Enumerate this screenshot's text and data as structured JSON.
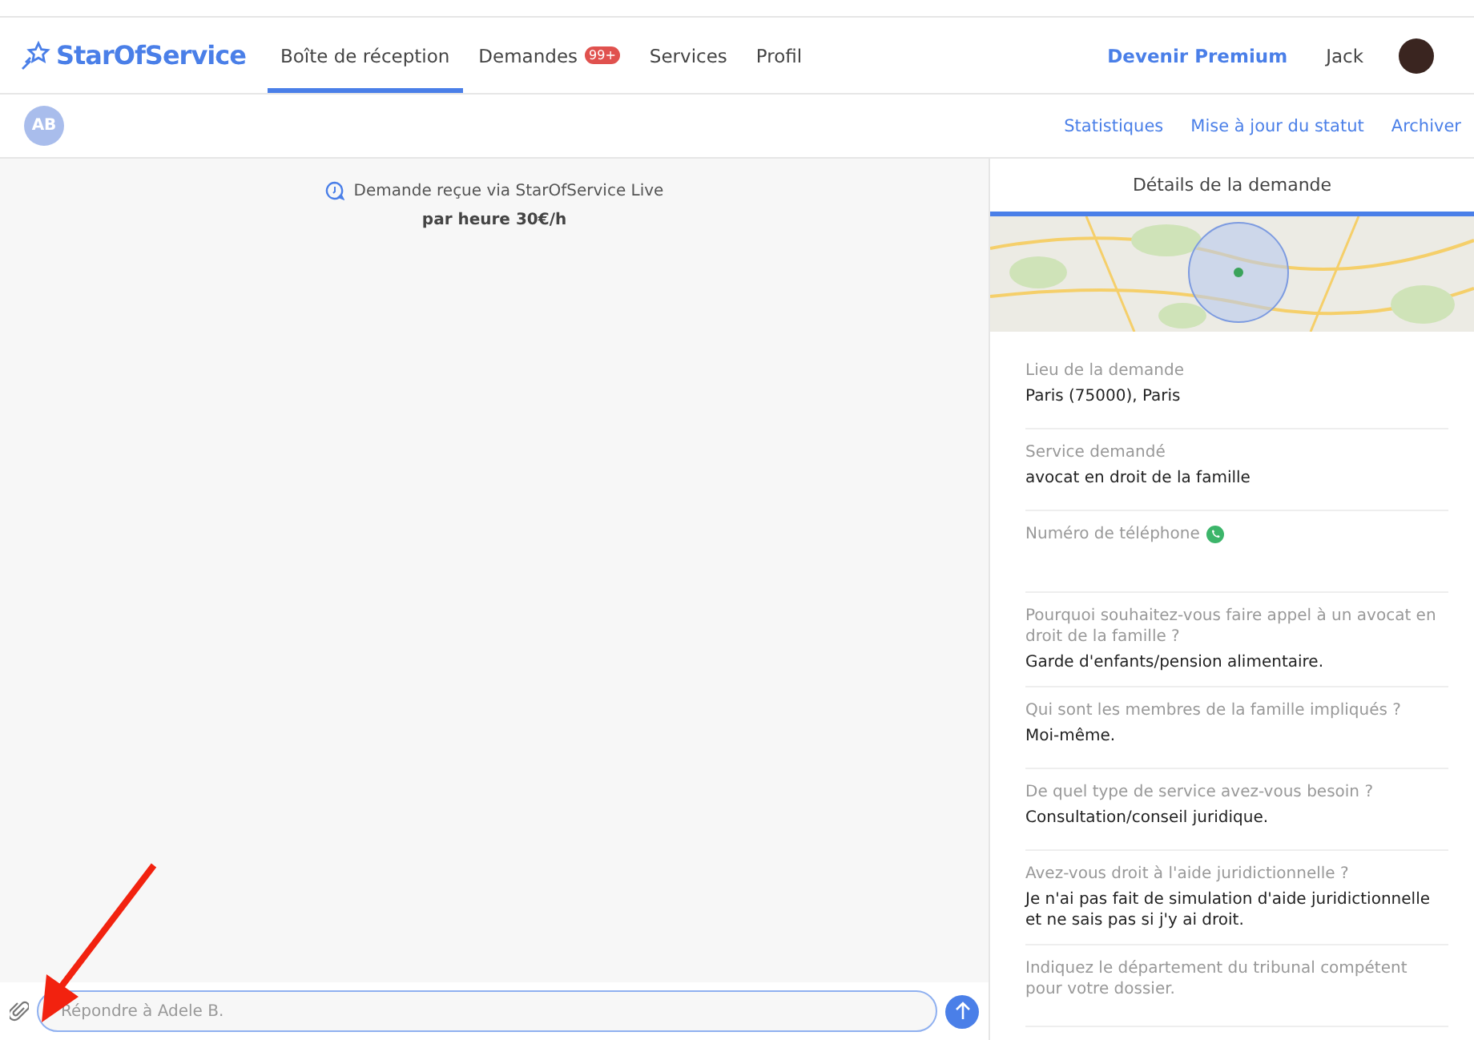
{
  "brand": "StarOfService",
  "nav": [
    {
      "label": "Boîte de réception",
      "selected": true
    },
    {
      "label": "Demandes",
      "selected": false,
      "badge": "99+"
    },
    {
      "label": "Services",
      "selected": false
    },
    {
      "label": "Profil",
      "selected": false
    }
  ],
  "premium": "Devenir Premium",
  "user": "Jack",
  "contact": {
    "initials": "AB"
  },
  "actions": [
    "Statistiques",
    "Mise à jour du statut",
    "Archiver"
  ],
  "notice": {
    "text": "Demande reçue via StarOfService Live",
    "price": "par heure 30€/h"
  },
  "composer": {
    "placeholder": "Répondre à Adele B."
  },
  "details": {
    "title": "Détails de la demande",
    "fields": [
      {
        "label": "Lieu de la demande",
        "value": "Paris (75000), Paris"
      },
      {
        "label": "Service demandé",
        "value": "avocat en droit de la famille"
      },
      {
        "label": "Numéro de téléphone",
        "phone": true
      },
      {
        "label": "Pourquoi souhaitez-vous faire appel à un avocat en droit de la famille ?",
        "value": "Garde d'enfants/pension alimentaire."
      },
      {
        "label": "Qui sont les membres de la famille impliqués ?",
        "value": "Moi-même."
      },
      {
        "label": "De quel type de service avez-vous besoin ?",
        "value": "Consultation/conseil juridique."
      },
      {
        "label": "Avez-vous droit à l'aide juridictionnelle ?",
        "value": "Je n'ai pas fait de simulation d'aide juridictionnelle et ne sais pas si j'y ai droit."
      },
      {
        "label": "Indiquez le département du tribunal compétent pour votre dossier."
      }
    ]
  }
}
